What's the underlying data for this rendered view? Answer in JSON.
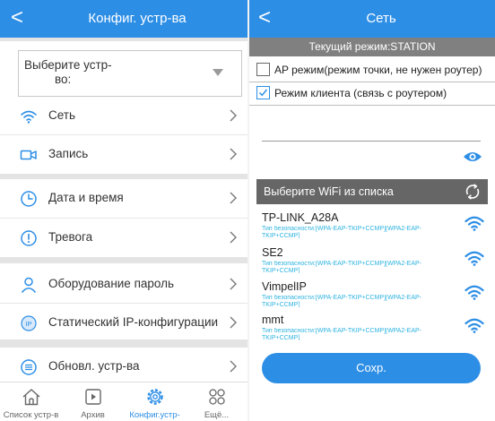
{
  "left": {
    "header": {
      "title": "Конфиг. устр-ва"
    },
    "device_select": {
      "line1": "Выберите устр-",
      "line2": "во:"
    },
    "menu": [
      {
        "label": "Сеть"
      },
      {
        "label": "Запись"
      },
      {
        "label": "Дата и время"
      },
      {
        "label": "Тревога"
      },
      {
        "label": "Оборудование пароль"
      },
      {
        "label": "Статический IP-конфигурации"
      },
      {
        "label": "Обновл. устр-ва"
      }
    ],
    "tabs": [
      {
        "label": "Список устр-в"
      },
      {
        "label": "Архив"
      },
      {
        "label": "Конфиг.устр-"
      },
      {
        "label": "Ещё..."
      }
    ]
  },
  "right": {
    "header": {
      "title": "Сеть"
    },
    "mode": "Текущий режим:STATION",
    "options": [
      {
        "label": "AP режим(режим точки, не нужен роутер)",
        "checked": false
      },
      {
        "label": "Режим клиента (связь с роутером)",
        "checked": true
      }
    ],
    "password": {
      "value": "",
      "placeholder": ""
    },
    "wifi_header": "Выберите WiFi из списка",
    "networks": [
      {
        "name": "TP-LINK_A28A",
        "security": "Тип безопасности:[WPA-EAP-TKIP+CCMP][WPA2-EAP-TKIP+CCMP]"
      },
      {
        "name": "SE2",
        "security": "Тип безопасности:[WPA-EAP-TKIP+CCMP][WPA2-EAP-TKIP+CCMP]"
      },
      {
        "name": "VimpelIP",
        "security": "Тип безопасности:[WPA-EAP-TKIP+CCMP][WPA2-EAP-TKIP+CCMP]"
      },
      {
        "name": "mmt",
        "security": "Тип безопасности:[WPA-EAP-TKIP+CCMP][WPA2-EAP-TKIP+CCMP]"
      }
    ],
    "save_label": "Сохр."
  },
  "colors": {
    "accent": "#2d8ee6",
    "mode_bar": "#808080",
    "wifi_header_bg": "#666666",
    "security_text": "#2db3e0",
    "icon": "#2d8ee6"
  }
}
